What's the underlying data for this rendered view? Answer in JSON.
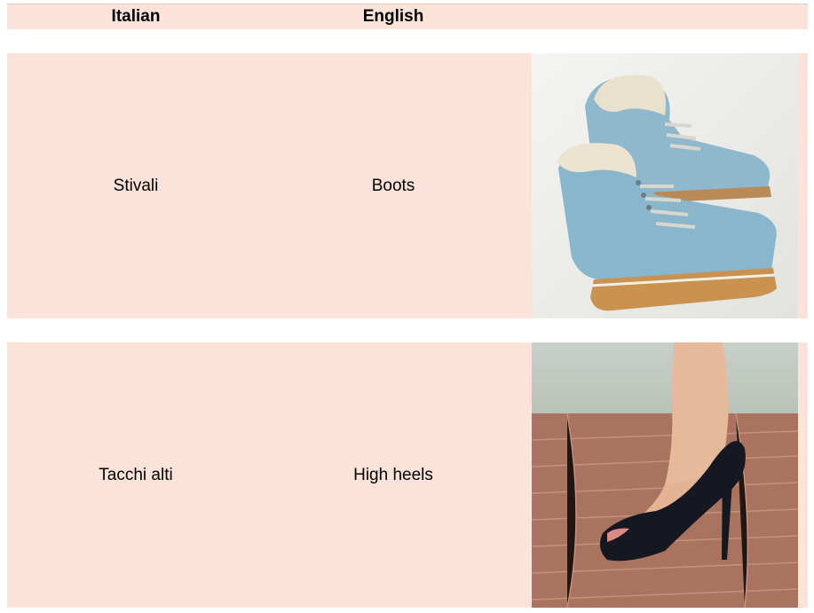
{
  "table": {
    "headers": {
      "italian": "Italian",
      "english": "English"
    },
    "rows": [
      {
        "italian": "Stivali",
        "english": "Boots",
        "image_icon": "blue-lace-up-boots-photo"
      },
      {
        "italian": "Tacchi alti",
        "english": "High heels",
        "image_icon": "black-high-heel-shoe-photo"
      }
    ]
  },
  "colors": {
    "row_background": "#fbe3d9",
    "page_background": "#ffffff"
  }
}
